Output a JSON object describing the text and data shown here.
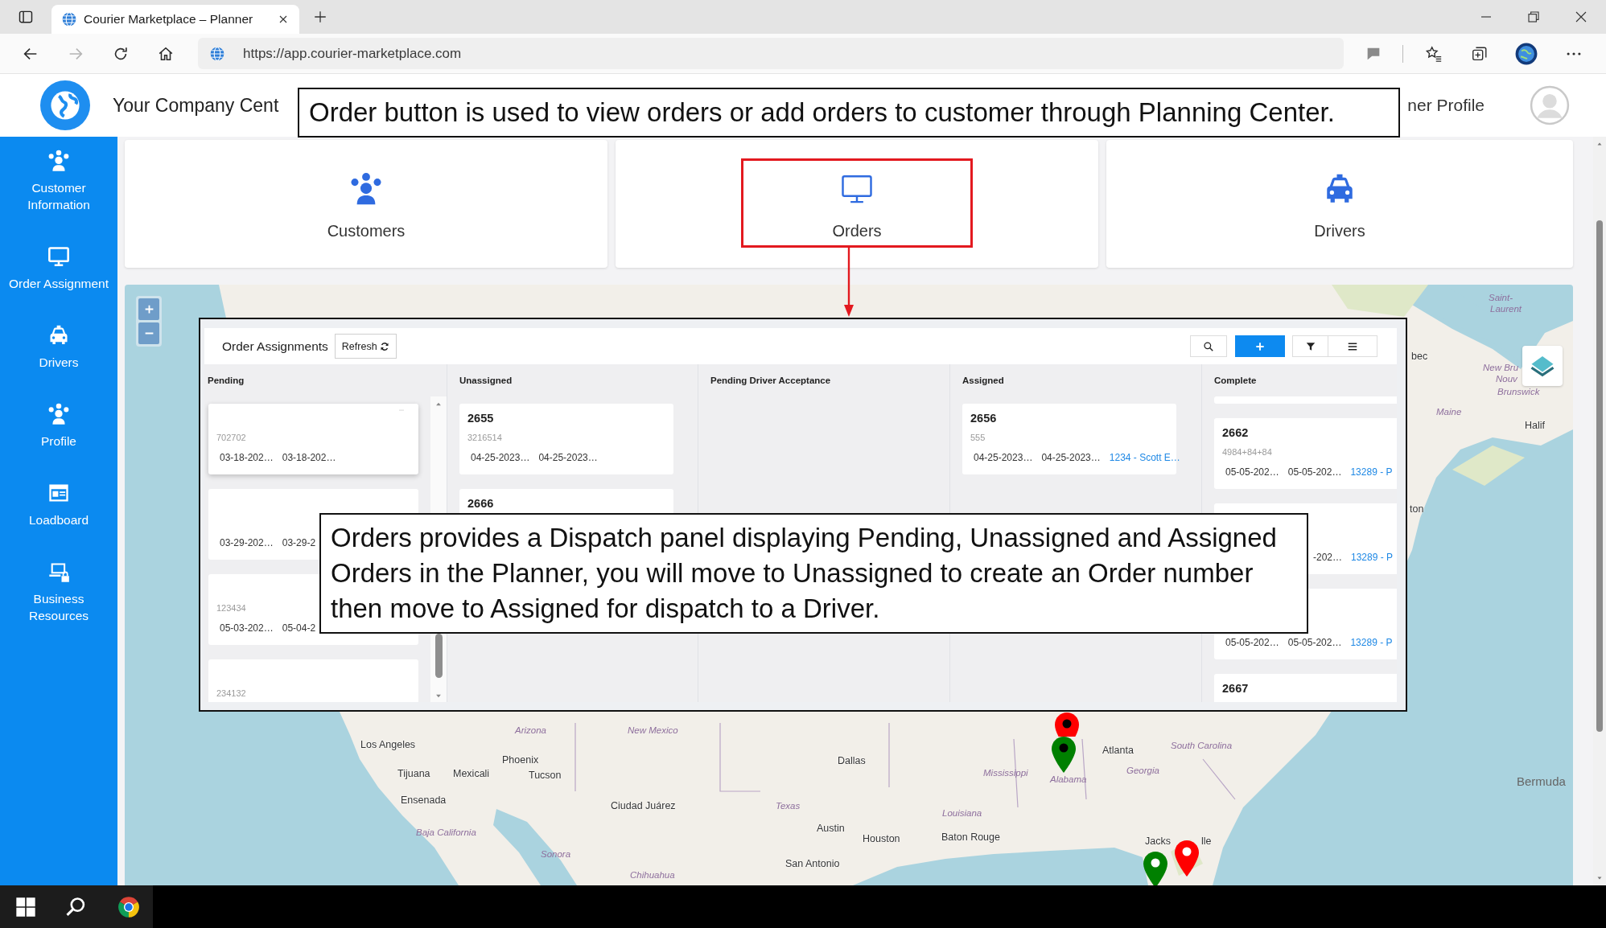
{
  "browser": {
    "tab_title": "Courier Marketplace – Planner",
    "url": "https://app.courier-marketplace.com"
  },
  "header": {
    "company": "Your Company Cent",
    "profile": "ner Profile"
  },
  "sidebar": {
    "items": [
      {
        "label": "Customer Information",
        "kind": "people"
      },
      {
        "label": "Order Assignment",
        "kind": "monitor"
      },
      {
        "label": "Drivers",
        "kind": "car"
      },
      {
        "label": "Profile",
        "kind": "people"
      },
      {
        "label": "Loadboard",
        "kind": "board"
      },
      {
        "label": "Business Resources",
        "kind": "laptop"
      }
    ]
  },
  "tiles": [
    {
      "label": "Customers",
      "kind": "people",
      "highlighted": false
    },
    {
      "label": "Orders",
      "kind": "monitor",
      "highlighted": true
    },
    {
      "label": "Drivers",
      "kind": "car",
      "highlighted": false
    }
  ],
  "callouts": {
    "top": "Order button is used to view orders or add orders to customer through Planning Center.",
    "panel": "Orders provides a Dispatch panel displaying Pending, Unassigned and Assigned Orders in the Planner, you will move to Unassigned to create an Order number then move to Assigned for dispatch to a Driver."
  },
  "order_panel": {
    "title": "Order Assignments",
    "refresh": "Refresh",
    "toolbar": [
      {
        "kind": "search"
      },
      {
        "kind": "add"
      },
      {
        "kind": "filter"
      },
      {
        "kind": "menu"
      }
    ],
    "columns": [
      {
        "title": "Pending",
        "scrollbar": true,
        "cards": [
          {
            "reference": "702702",
            "dates": [
              "03-18-202…",
              "03-18-202…"
            ],
            "selected": true
          },
          {
            "dates": [
              "03-29-202…",
              "03-29-2"
            ],
            "selected": false
          },
          {
            "reference": "123434",
            "dates": [
              "05-03-202…",
              "05-04-2"
            ],
            "selected": false
          },
          {
            "reference": "234132",
            "selected": false
          }
        ]
      },
      {
        "title": "Unassigned",
        "scrollbar": false,
        "cards": [
          {
            "number": "2655",
            "reference": "3216514",
            "dates": [
              "04-25-2023…",
              "04-25-2023…"
            ],
            "selected": false
          },
          {
            "number": "2666",
            "selected": false
          }
        ]
      },
      {
        "title": "Pending Driver Acceptance",
        "scrollbar": false
      },
      {
        "title": "Assigned",
        "scrollbar": false,
        "cards": [
          {
            "number": "2656",
            "reference": "555",
            "dates": [
              "04-25-2023…",
              "04-25-2023…"
            ],
            "driver": "1234 - Scott E…",
            "selected": false
          }
        ]
      },
      {
        "title": "Complete",
        "scrollbar": false,
        "cards": [
          {
            "kind": "clipped",
            "selected": false
          },
          {
            "kind": "order",
            "number": "2662",
            "reference": "4984+84+84",
            "dates": [
              "05-05-202…",
              "05-05-202…"
            ],
            "driver": "13289 - P",
            "selected": false
          },
          {
            "kind": "order",
            "date_tail": "-202…",
            "driver": "13289 - P",
            "selected": false
          },
          {
            "kind": "order",
            "dates": [
              "05-05-202…",
              "05-05-202…"
            ],
            "driver": "13289 - P",
            "selected": false
          },
          {
            "kind": "order",
            "number": "2667",
            "selected": false
          }
        ]
      }
    ]
  },
  "map": {
    "labels": [
      {
        "text": "Saint-",
        "kind": "region"
      },
      {
        "text": "Laurent",
        "kind": "region"
      },
      {
        "text": "bec",
        "kind": "place"
      },
      {
        "text": "New Bru",
        "kind": "region"
      },
      {
        "text": "Nouv",
        "kind": "region"
      },
      {
        "text": "Brunswick",
        "kind": "region"
      },
      {
        "text": "Maine",
        "kind": "region"
      },
      {
        "text": "Halif",
        "kind": "place"
      },
      {
        "text": "ton",
        "kind": "place"
      },
      {
        "text": "Arizona",
        "kind": "region"
      },
      {
        "text": "New Mexico",
        "kind": "region"
      },
      {
        "text": "Los Angeles",
        "kind": "place"
      },
      {
        "text": "Atlanta",
        "kind": "place"
      },
      {
        "text": "South Carolina",
        "kind": "region"
      },
      {
        "text": "Phoenix",
        "kind": "place"
      },
      {
        "text": "Dallas",
        "kind": "place"
      },
      {
        "text": "Tijuana",
        "kind": "place"
      },
      {
        "text": "Mexicali",
        "kind": "place"
      },
      {
        "text": "Tucson",
        "kind": "place"
      },
      {
        "text": "Mississippi",
        "kind": "region"
      },
      {
        "text": "Alabama",
        "kind": "region"
      },
      {
        "text": "Georgia",
        "kind": "region"
      },
      {
        "text": "Bermuda",
        "kind": "major"
      },
      {
        "text": "Ensenada",
        "kind": "place"
      },
      {
        "text": "Ciudad Juárez",
        "kind": "place"
      },
      {
        "text": "Texas",
        "kind": "region"
      },
      {
        "text": "Louisiana",
        "kind": "region"
      },
      {
        "text": "Baja California",
        "kind": "region"
      },
      {
        "text": "Austin",
        "kind": "place"
      },
      {
        "text": "Houston",
        "kind": "place"
      },
      {
        "text": "Baton Rouge",
        "kind": "place"
      },
      {
        "text": "Jacks",
        "kind": "place"
      },
      {
        "text": "lle",
        "kind": "place"
      },
      {
        "text": "Sonora",
        "kind": "region"
      },
      {
        "text": "San Antonio",
        "kind": "place"
      },
      {
        "text": "Chihuahua",
        "kind": "region"
      }
    ],
    "pins": [
      {
        "color": "#ff0000",
        "kind": "dark"
      },
      {
        "color": "#008000",
        "kind": "dark"
      },
      {
        "color": "#ff0000",
        "kind": "light"
      },
      {
        "color": "#008000",
        "kind": "light"
      }
    ]
  }
}
